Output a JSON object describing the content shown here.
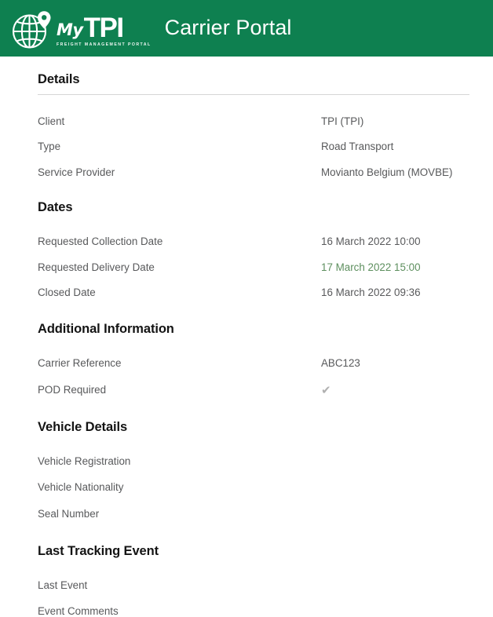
{
  "header": {
    "brand": {
      "wordmark_my": "My",
      "wordmark_tpi": "TPI",
      "tagline": "FREIGHT MANAGEMENT PORTAL",
      "globe_icon": "globe-location-pin-icon"
    },
    "title": "Carrier Portal",
    "background_color": "#0e8050"
  },
  "sections": [
    {
      "key": "details",
      "title": "Details",
      "has_rule": true,
      "fields": [
        {
          "label": "Client",
          "value": "TPI (TPI)",
          "style": "normal"
        },
        {
          "label": "Type",
          "value": "Road Transport",
          "style": "normal"
        },
        {
          "label": "Service Provider",
          "value": "Movianto Belgium (MOVBE)",
          "style": "normal"
        }
      ]
    },
    {
      "key": "dates",
      "title": "Dates",
      "has_rule": false,
      "fields": [
        {
          "label": "Requested Collection Date",
          "value": "16 March 2022 10:00",
          "style": "normal"
        },
        {
          "label": "Requested Delivery Date",
          "value": "17 March 2022 15:00",
          "style": "accent-green"
        },
        {
          "label": "Closed Date",
          "value": "16 March 2022 09:36",
          "style": "normal"
        }
      ]
    },
    {
      "key": "additional",
      "title": "Additional Information",
      "has_rule": false,
      "fields": [
        {
          "label": "Carrier Reference",
          "value": "ABC123",
          "style": "normal"
        },
        {
          "label": "POD Required",
          "value": "✔",
          "style": "check-mark",
          "icon": "check-mark-icon"
        }
      ]
    },
    {
      "key": "vehicle",
      "title": "Vehicle Details",
      "has_rule": false,
      "fields": [
        {
          "label": "Vehicle Registration",
          "value": "",
          "style": "normal"
        },
        {
          "label": "Vehicle Nationality",
          "value": "",
          "style": "normal"
        },
        {
          "label": "Seal Number",
          "value": "",
          "style": "normal"
        }
      ]
    },
    {
      "key": "tracking",
      "title": "Last Tracking Event",
      "has_rule": false,
      "fields": [
        {
          "label": "Last Event",
          "value": "",
          "style": "normal"
        },
        {
          "label": "Event Comments",
          "value": "",
          "style": "normal"
        }
      ]
    }
  ],
  "colors": {
    "header_green": "#0e8050",
    "accent_green_text": "#5d8f5e",
    "label_gray": "#58595b",
    "heading_black": "#141414",
    "rule_gray": "#d6d6d6",
    "check_gray": "#b0b0b0"
  }
}
